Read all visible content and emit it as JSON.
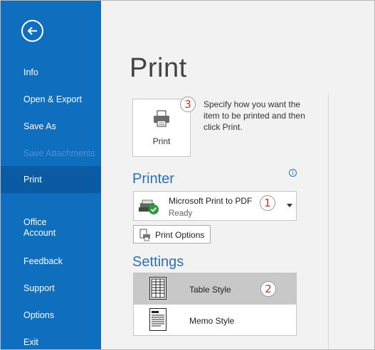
{
  "sidebar": {
    "items": [
      {
        "label": "Info"
      },
      {
        "label": "Open & Export"
      },
      {
        "label": "Save As"
      },
      {
        "label": "Save Attachments"
      },
      {
        "label": "Print"
      },
      {
        "label": "Office Account"
      },
      {
        "label": "Feedback"
      },
      {
        "label": "Support"
      },
      {
        "label": "Options"
      },
      {
        "label": "Exit"
      }
    ],
    "active_item": "Print",
    "disabled_item": "Save Attachments",
    "color": "#106ebe"
  },
  "main": {
    "title": "Print",
    "print_button_label": "Print",
    "description": "Specify how you want the item to be printed and then click Print.",
    "printer_heading": "Printer",
    "printer": {
      "name": "Microsoft Print to PDF",
      "status": "Ready"
    },
    "print_options_label": "Print Options",
    "settings_heading": "Settings",
    "styles": [
      {
        "label": "Table Style",
        "selected": true
      },
      {
        "label": "Memo Style",
        "selected": false
      }
    ]
  },
  "annotations": {
    "step1": "1",
    "step2": "2",
    "step3": "3"
  },
  "colors": {
    "accent": "#2b70b6",
    "step_number": "#c0392b"
  },
  "icons": [
    "back-arrow-icon",
    "printer-icon",
    "info-icon",
    "printer-ready-icon",
    "print-options-icon",
    "table-style-icon",
    "memo-style-icon"
  ]
}
